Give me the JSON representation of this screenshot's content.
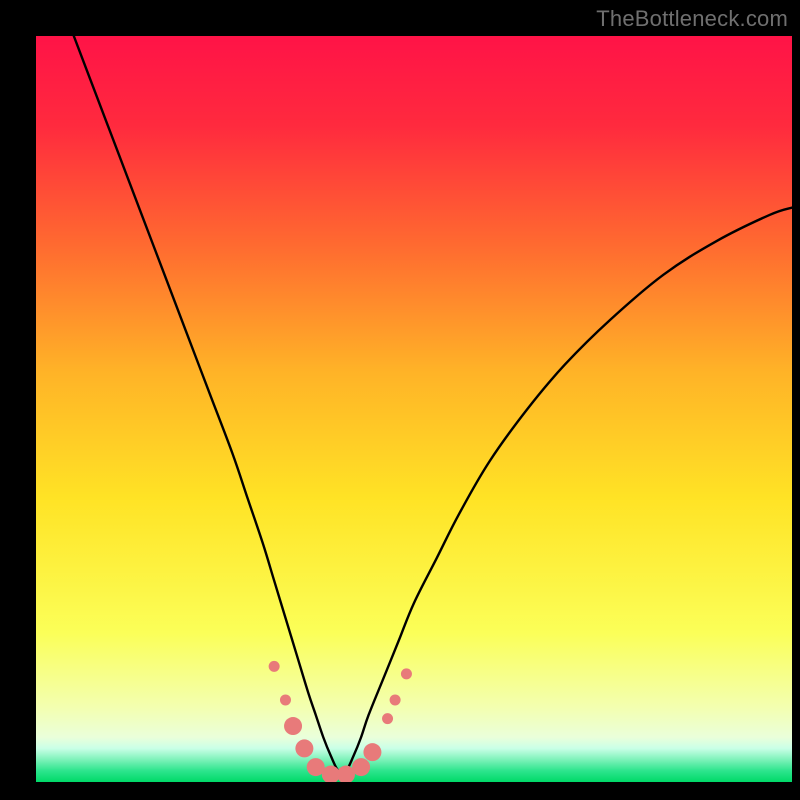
{
  "watermark": "TheBottleneck.com",
  "chart_data": {
    "type": "line",
    "title": "",
    "xlabel": "",
    "ylabel": "",
    "xlim": [
      0,
      100
    ],
    "ylim": [
      0,
      100
    ],
    "grid": false,
    "legend": false,
    "gradient_colors": {
      "top": "#ff1347",
      "upper_mid": "#ff8a2f",
      "mid": "#ffe325",
      "lower_mid": "#f6ff8a",
      "bottom_band": "#00e57a",
      "bottom_band_light": "#c9ffe7"
    },
    "series": [
      {
        "name": "curve",
        "color": "#000000",
        "x": [
          5,
          8,
          11,
          14,
          17,
          20,
          23,
          26,
          28,
          30,
          31.5,
          33,
          34.5,
          36,
          37,
          38,
          39,
          40,
          41,
          42,
          43,
          44,
          46,
          48,
          50,
          53,
          56,
          60,
          65,
          70,
          76,
          83,
          90,
          97,
          100
        ],
        "y": [
          100,
          92,
          84,
          76,
          68,
          60,
          52,
          44,
          38,
          32,
          27,
          22,
          17,
          12,
          9,
          6,
          3.5,
          1.5,
          1.5,
          3.5,
          6,
          9,
          14,
          19,
          24,
          30,
          36,
          43,
          50,
          56,
          62,
          68,
          72.5,
          76,
          77
        ]
      }
    ],
    "markers": {
      "name": "dots",
      "color": "#e87a7a",
      "radius_small": 5.5,
      "radius_large": 9,
      "points": [
        {
          "x": 31.5,
          "y": 15.5,
          "r": "small"
        },
        {
          "x": 33.0,
          "y": 11.0,
          "r": "small"
        },
        {
          "x": 34.0,
          "y": 7.5,
          "r": "large"
        },
        {
          "x": 35.5,
          "y": 4.5,
          "r": "large"
        },
        {
          "x": 37.0,
          "y": 2.0,
          "r": "large"
        },
        {
          "x": 39.0,
          "y": 1.0,
          "r": "large"
        },
        {
          "x": 41.0,
          "y": 1.0,
          "r": "large"
        },
        {
          "x": 43.0,
          "y": 2.0,
          "r": "large"
        },
        {
          "x": 44.5,
          "y": 4.0,
          "r": "large"
        },
        {
          "x": 46.5,
          "y": 8.5,
          "r": "small"
        },
        {
          "x": 47.5,
          "y": 11.0,
          "r": "small"
        },
        {
          "x": 49.0,
          "y": 14.5,
          "r": "small"
        }
      ]
    }
  }
}
